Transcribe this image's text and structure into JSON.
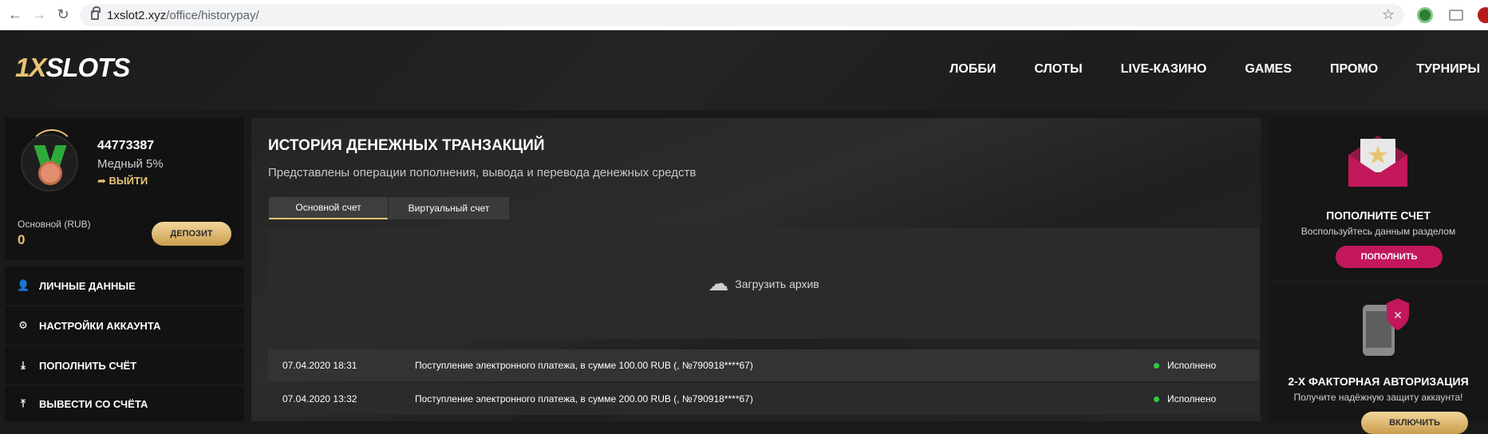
{
  "browser": {
    "url_host": "1xslot2.xyz",
    "url_path": "/office/historypay/"
  },
  "header": {
    "logo_main": "1X",
    "logo_rest": "SLOTS",
    "nav": [
      "ЛОББИ",
      "СЛОТЫ",
      "LIVE-КАЗИНО",
      "GAMES",
      "ПРОМО",
      "ТУРНИРЫ"
    ]
  },
  "profile": {
    "user_id": "44773387",
    "level": "Медный 5%",
    "logout_label": "ВЫЙТИ",
    "balance_label": "Основной (RUB)",
    "balance_value": "0",
    "deposit_label": "ДЕПОЗИТ"
  },
  "sidebar": {
    "items": [
      {
        "label": "ЛИЧНЫЕ ДАННЫЕ",
        "icon": "user-plus-icon"
      },
      {
        "label": "НАСТРОЙКИ АККАУНТА",
        "icon": "gears-icon"
      },
      {
        "label": "ПОПОЛНИТЬ СЧЁТ",
        "icon": "download-icon"
      },
      {
        "label": "ВЫВЕСТИ СО СЧЁТА",
        "icon": "upload-icon"
      }
    ]
  },
  "main": {
    "title": "ИСТОРИЯ ДЕНЕЖНЫХ ТРАНЗАКЦИЙ",
    "subtitle": "Представлены операции пополнения, вывода и перевода денежных средств",
    "tabs": [
      {
        "label": "Основной счет",
        "active": true
      },
      {
        "label": "Виртуальный счет",
        "active": false
      }
    ],
    "archive_label": "Загрузить архив",
    "transactions": [
      {
        "date": "07.04.2020 18:31",
        "description": "Поступление электронного платежа, в сумме 100.00 RUB (, №790918****67)",
        "status": "Исполнено"
      },
      {
        "date": "07.04.2020 13:32",
        "description": "Поступление электронного платежа, в сумме 200.00 RUB (, №790918****67)",
        "status": "Исполнено"
      }
    ]
  },
  "right": {
    "deposit_title": "ПОПОЛНИТЕ СЧЕТ",
    "deposit_text": "Воспользуйтесь данным разделом",
    "deposit_button": "ПОПОЛНИТЬ",
    "twofa_title": "2-Х ФАКТОРНАЯ АВТОРИЗАЦИЯ",
    "twofa_text": "Получите надёжную защиту аккаунта!",
    "twofa_button": "ВКЛЮЧИТЬ"
  },
  "colors": {
    "accent_gold": "#e8c373",
    "button_crimson": "#c2185b",
    "status_green": "#2ecc40"
  }
}
